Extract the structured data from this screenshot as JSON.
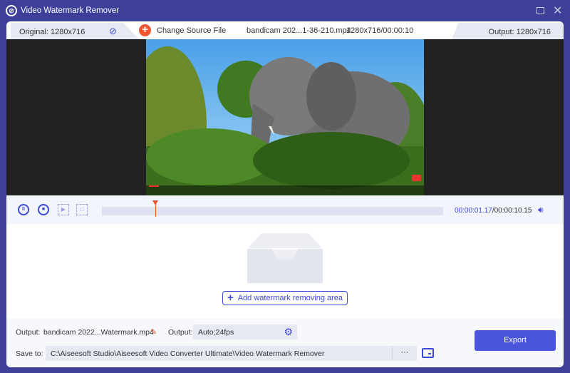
{
  "window": {
    "title": "Video Watermark Remover"
  },
  "topbar": {
    "original": "Original: 1280x716",
    "change_source": "Change Source File",
    "file_name": "bandicam 202...1-36-210.mp4",
    "file_info": "1280x716/00:00:10",
    "output": "Output: 1280x716"
  },
  "player": {
    "current_time": "00:00:01.17",
    "total_time": "/00:00:10.15",
    "progress_fraction": 0.157
  },
  "area": {
    "add_label": "Add watermark removing area"
  },
  "bottom": {
    "output_label": "Output:",
    "output_file": "bandicam 2022...Watermark.mp4",
    "format_label": "Output:",
    "format_value": "Auto;24fps",
    "save_label": "Save to:",
    "save_path": "C:\\Aiseesoft Studio\\Aiseesoft Video Converter Ultimate\\Video Watermark Remover",
    "browse": "···",
    "export": "Export"
  },
  "colors": {
    "frame": "#3d3f99",
    "accent": "#3d49d8",
    "orange": "#f2572f"
  }
}
